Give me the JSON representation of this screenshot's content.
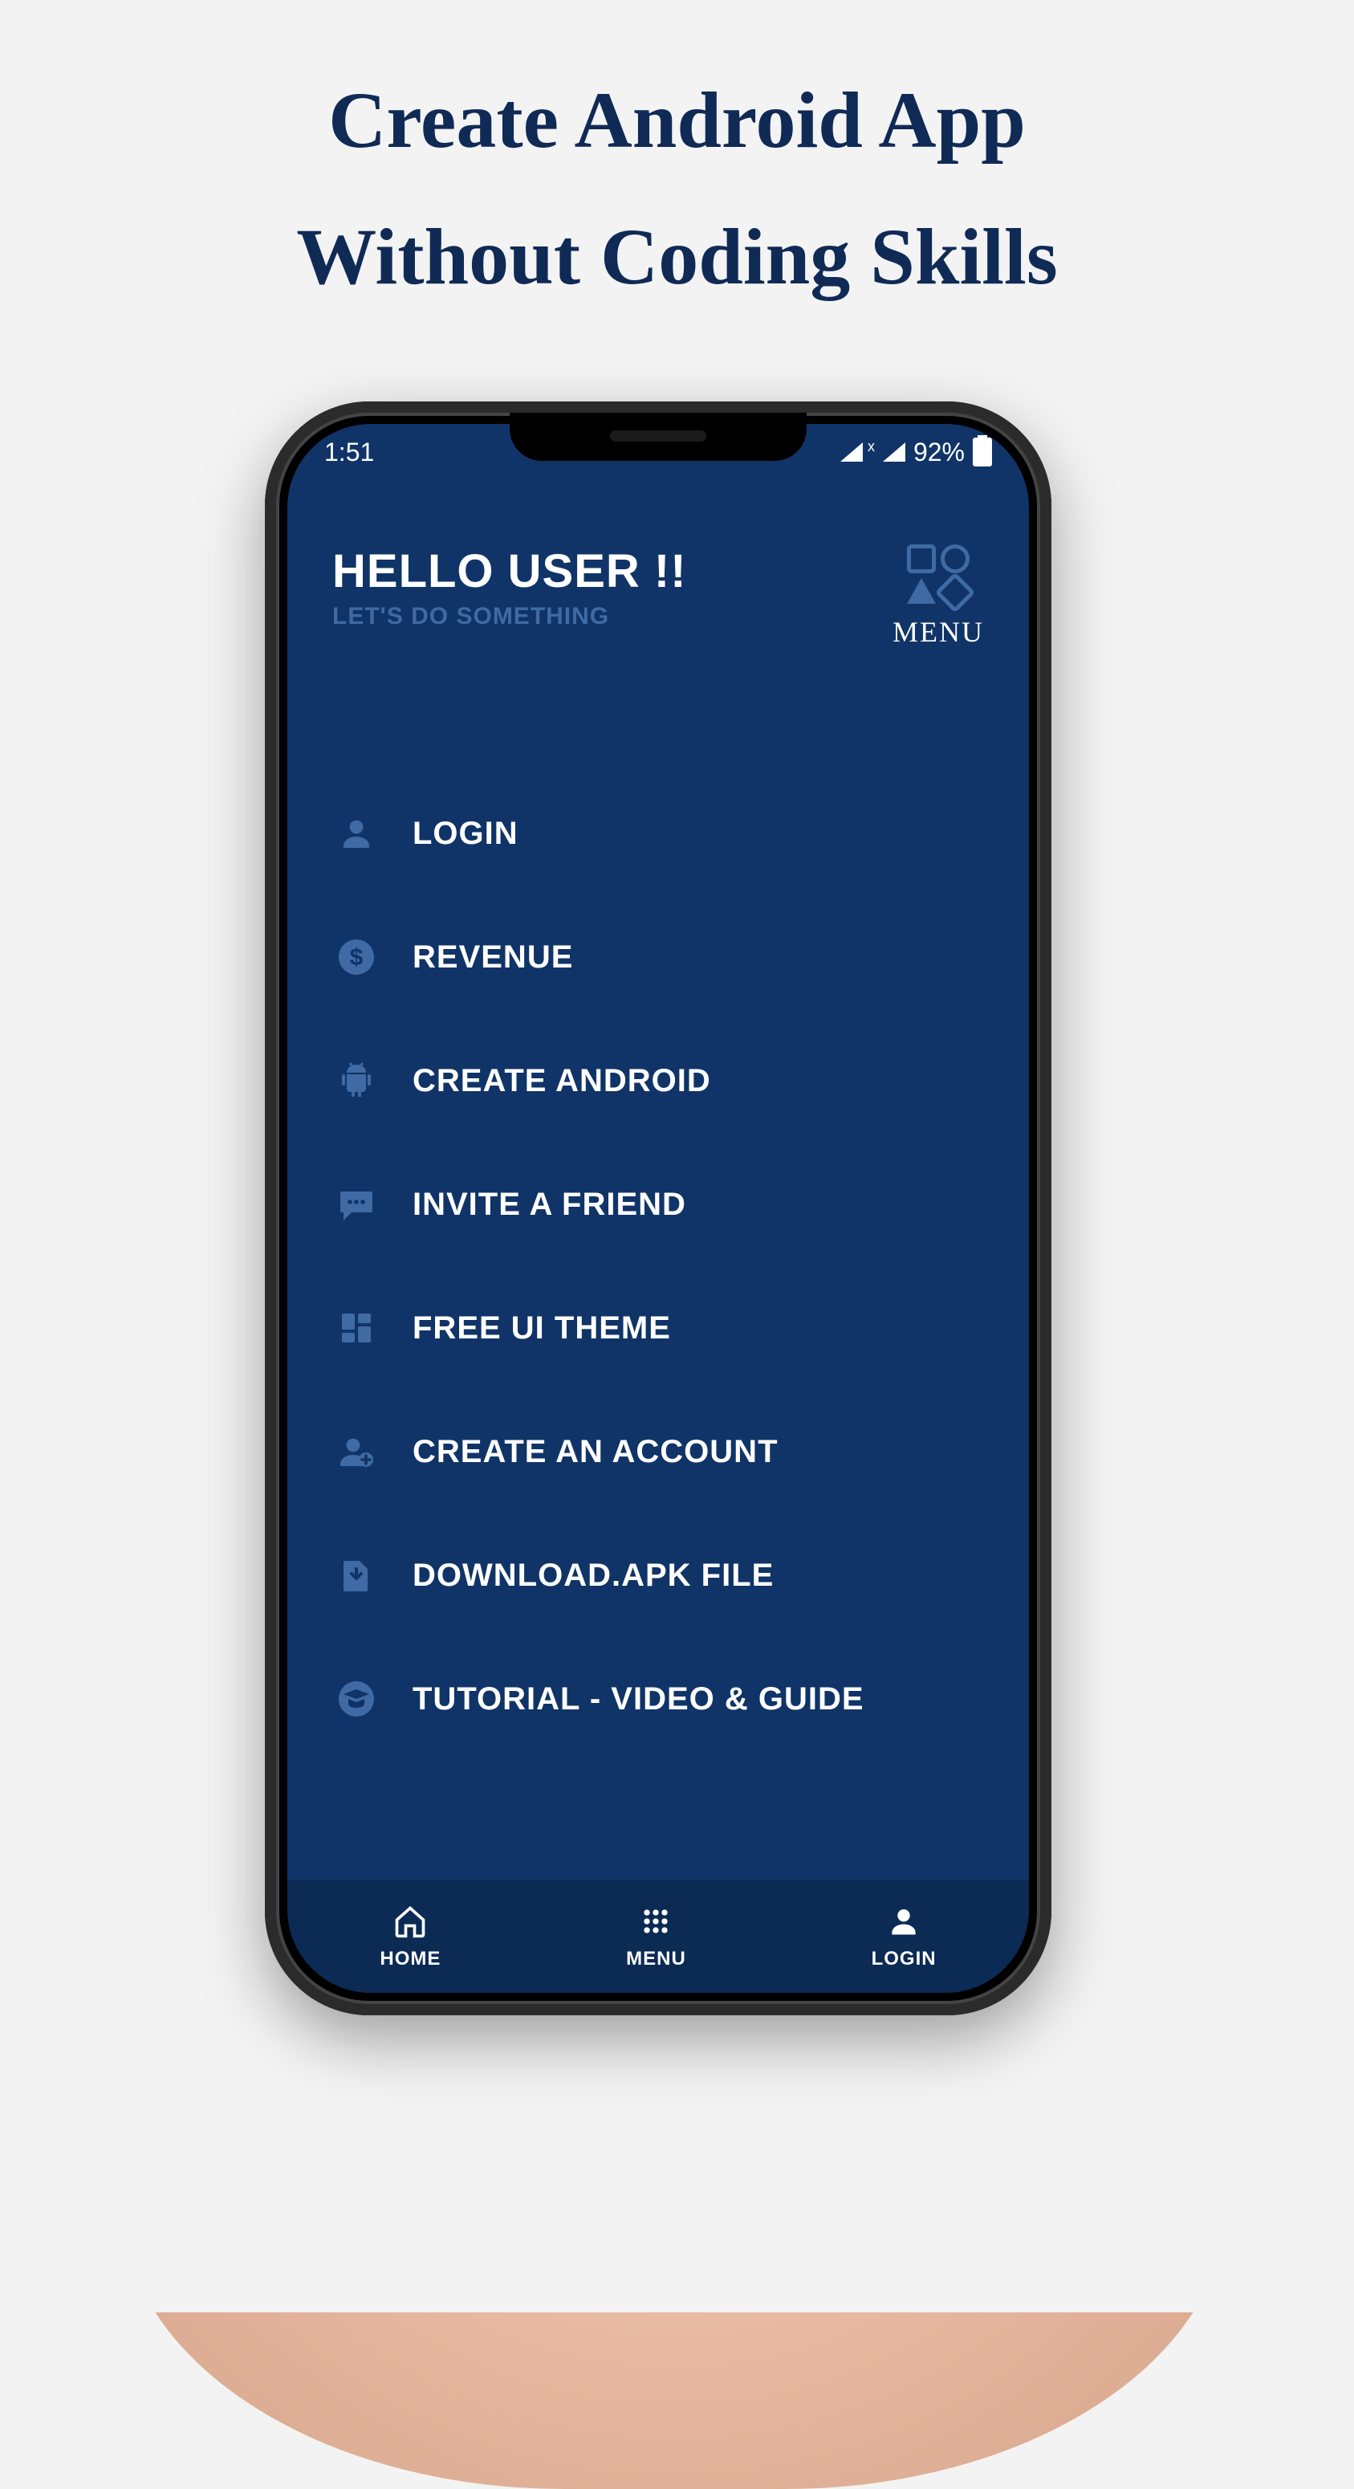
{
  "headline": {
    "line1": "Create Android App",
    "line2": "Without Coding Skills"
  },
  "statusbar": {
    "time": "1:51",
    "battery": "92%"
  },
  "header": {
    "greeting_title": "HELLO USER !!",
    "greeting_sub": "LET'S DO SOMETHING",
    "menu_label": "MENU"
  },
  "menu_items": [
    {
      "icon": "person-icon",
      "label": "LOGIN"
    },
    {
      "icon": "dollar-icon",
      "label": "REVENUE"
    },
    {
      "icon": "android-icon",
      "label": "CREATE ANDROID"
    },
    {
      "icon": "chat-icon",
      "label": "INVITE A FRIEND"
    },
    {
      "icon": "grid-icon",
      "label": "FREE UI THEME"
    },
    {
      "icon": "add-user-icon",
      "label": "CREATE AN ACCOUNT"
    },
    {
      "icon": "download-icon",
      "label": "DOWNLOAD.APK FILE"
    },
    {
      "icon": "cap-icon",
      "label": "TUTORIAL - VIDEO & GUIDE"
    }
  ],
  "bottom_nav": [
    {
      "icon": "home-icon",
      "label": "HOME"
    },
    {
      "icon": "dots-icon",
      "label": "MENU"
    },
    {
      "icon": "person-icon",
      "label": "LOGIN"
    }
  ],
  "colors": {
    "screen_bg": "#103467",
    "accent": "#3f6aa3",
    "headline": "#102a56"
  }
}
